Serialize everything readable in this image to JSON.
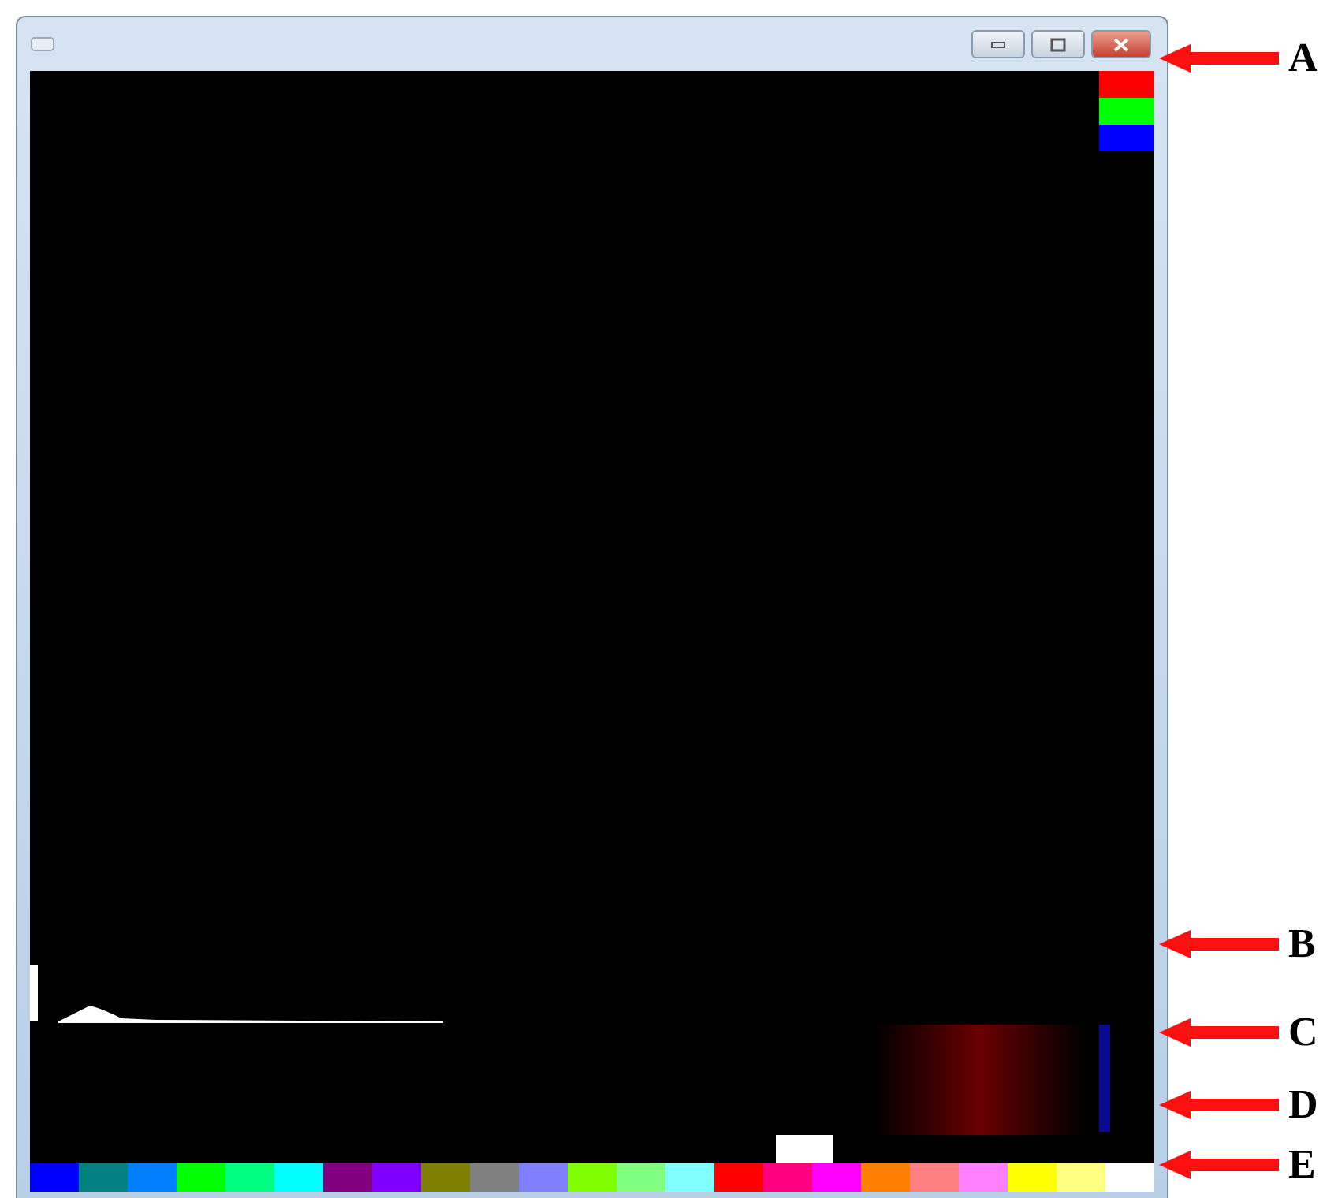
{
  "channel_swatches": [
    {
      "color": "#ff0000"
    },
    {
      "color": "#00ff00"
    },
    {
      "color": "#0000ff"
    }
  ],
  "palette": [
    {
      "color": "#0000ff",
      "selected": false
    },
    {
      "color": "#008080",
      "selected": false
    },
    {
      "color": "#0080ff",
      "selected": false
    },
    {
      "color": "#00ff00",
      "selected": false
    },
    {
      "color": "#00ff80",
      "selected": false
    },
    {
      "color": "#00ffff",
      "selected": false
    },
    {
      "color": "#800080",
      "selected": false
    },
    {
      "color": "#8000ff",
      "selected": false
    },
    {
      "color": "#808000",
      "selected": false
    },
    {
      "color": "#808080",
      "selected": false
    },
    {
      "color": "#8080ff",
      "selected": false
    },
    {
      "color": "#80ff00",
      "selected": false
    },
    {
      "color": "#80ff80",
      "selected": false
    },
    {
      "color": "#80ffff",
      "selected": false
    },
    {
      "color": "#ff0000",
      "selected": false
    },
    {
      "color": "#ff0080",
      "selected": true
    },
    {
      "color": "#ff00ff",
      "selected": false
    },
    {
      "color": "#ff8000",
      "selected": false
    },
    {
      "color": "#ff8080",
      "selected": false
    },
    {
      "color": "#ff80ff",
      "selected": false
    },
    {
      "color": "#ffff00",
      "selected": false
    },
    {
      "color": "#ffff80",
      "selected": false
    },
    {
      "color": "#ffffff",
      "selected": false
    }
  ],
  "annotations": [
    {
      "label": "A"
    },
    {
      "label": "B"
    },
    {
      "label": "C"
    },
    {
      "label": "D"
    },
    {
      "label": "E"
    }
  ]
}
